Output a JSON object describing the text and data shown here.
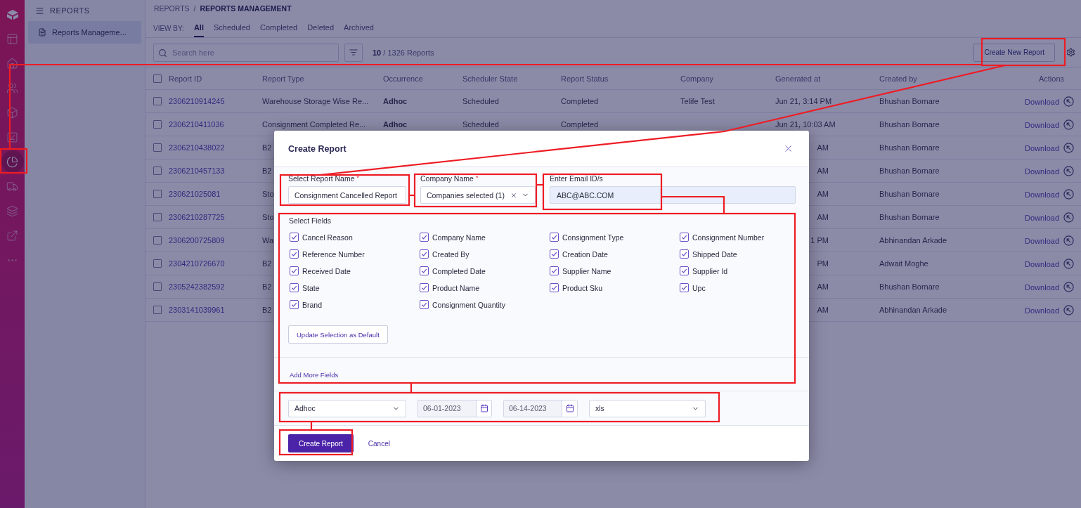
{
  "rail": {
    "items": [
      {
        "kind": "logo",
        "selected": false
      },
      {
        "kind": "layout",
        "selected": false
      },
      {
        "kind": "home",
        "selected": false
      },
      {
        "kind": "users",
        "selected": false
      },
      {
        "kind": "box",
        "selected": false
      },
      {
        "kind": "inbound",
        "selected": false
      },
      {
        "kind": "reports",
        "selected": true
      },
      {
        "kind": "truck",
        "selected": false
      },
      {
        "kind": "layers",
        "selected": false
      },
      {
        "kind": "external",
        "selected": false
      },
      {
        "kind": "more",
        "selected": false
      }
    ]
  },
  "sidebar": {
    "title": "REPORTS",
    "items": [
      {
        "label": "Reports Manageme...",
        "selected": true
      }
    ]
  },
  "breadcrumb": {
    "items": [
      "REPORTS",
      "REPORTS MANAGEMENT"
    ],
    "separator": "/"
  },
  "view_by": {
    "label": "VIEW BY:",
    "tabs": [
      {
        "label": "All",
        "selected": true
      },
      {
        "label": "Scheduled",
        "selected": false
      },
      {
        "label": "Completed",
        "selected": false
      },
      {
        "label": "Deleted",
        "selected": false
      },
      {
        "label": "Archived",
        "selected": false
      }
    ]
  },
  "toolbar": {
    "search_placeholder": "Search here",
    "count": "**10** / 1326 Reports",
    "create_button": "Create New Report"
  },
  "table": {
    "all_checked": false,
    "columns": [
      "Report ID",
      "Report Type",
      "Occurrence",
      "Scheduler State",
      "Report Status",
      "Company",
      "Generated at",
      "Created by",
      "Actions"
    ],
    "rows": [
      {
        "checked": false,
        "id": "2306210914245",
        "type": "Warehouse Storage Wise Re...",
        "occurrence": "Adhoc",
        "scheduler_state": "Scheduled",
        "status": "Completed",
        "company": "Telife Test",
        "generated_at": "Jun 21, 3:14 PM",
        "generated_cut": false,
        "created_by": "Bhushan Bornare",
        "action": "Download"
      },
      {
        "checked": false,
        "id": "2306210411036",
        "type": "Consignment Completed Re...",
        "occurrence": "Adhoc",
        "scheduler_state": "Scheduled",
        "status": "Completed",
        "generated_at": "Jun 21, 10:03 AM",
        "generated_cut": false,
        "created_by": "Bhushan Bornare",
        "action": "Download"
      },
      {
        "checked": false,
        "id": "2306210438022",
        "type": "B2",
        "generated_at": "AM",
        "generated_cut": true,
        "created_by": "Bhushan Bornare",
        "action": "Download"
      },
      {
        "checked": false,
        "id": "2306210457133",
        "type": "B2",
        "generated_at": "AM",
        "generated_cut": true,
        "created_by": "Bhushan Bornare",
        "action": "Download"
      },
      {
        "checked": false,
        "id": "230621025081",
        "type": "Sto",
        "generated_at": "AM",
        "generated_cut": true,
        "created_by": "Bhushan Bornare",
        "action": "Download"
      },
      {
        "checked": false,
        "id": "2306210287725",
        "type": "Sto",
        "generated_at": "AM",
        "generated_cut": true,
        "created_by": "Bhushan Bornare",
        "action": "Download"
      },
      {
        "checked": false,
        "id": "2306200725809",
        "type": "Wa",
        "generated_at": "1 PM",
        "generated_cut": true,
        "created_by": "Abhinandan Arkade",
        "action": "Download"
      },
      {
        "checked": false,
        "id": "2304210726670",
        "type": "B2",
        "generated_at": "PM",
        "generated_cut": true,
        "created_by": "Adwait Moghe",
        "action": "Download"
      },
      {
        "checked": false,
        "id": "2305242382592",
        "type": "B2",
        "generated_at": "AM",
        "generated_cut": true,
        "created_by": "Bhushan Bornare",
        "action": "Download"
      },
      {
        "checked": false,
        "id": "2303141039961",
        "type": "B2",
        "generated_at": "AM",
        "generated_cut": true,
        "created_by": "Abhinandan Arkade",
        "action": "Download"
      }
    ]
  },
  "modal": {
    "title": "Create Report",
    "report_name": {
      "label": "Select Report Name",
      "required_mark": "*",
      "value": "Consignment Cancelled Report"
    },
    "company": {
      "label": "Company Name",
      "required_mark": "*",
      "value": "Companies selected (1)"
    },
    "email": {
      "label": "Enter Email ID/s",
      "value": "ABC@ABC.COM"
    },
    "fields_title": "Select Fields",
    "fields": [
      {
        "label": "Cancel Reason",
        "checked": true
      },
      {
        "label": "Company Name",
        "checked": true
      },
      {
        "label": "Consignment Type",
        "checked": true
      },
      {
        "label": "Consignment Number",
        "checked": true
      },
      {
        "label": "Reference Number",
        "checked": true
      },
      {
        "label": "Created By",
        "checked": true
      },
      {
        "label": "Creation Date",
        "checked": true
      },
      {
        "label": "Shipped Date",
        "checked": true
      },
      {
        "label": "Received Date",
        "checked": true
      },
      {
        "label": "Completed Date",
        "checked": true
      },
      {
        "label": "Supplier Name",
        "checked": true
      },
      {
        "label": "Supplier Id",
        "checked": true
      },
      {
        "label": "State",
        "checked": true
      },
      {
        "label": "Product Name",
        "checked": true
      },
      {
        "label": "Product Sku",
        "checked": true
      },
      {
        "label": "Upc",
        "checked": true
      },
      {
        "label": "Brand",
        "checked": true
      },
      {
        "label": "Consignment Quantity",
        "checked": true
      }
    ],
    "update_button": "Update Selection as Default",
    "add_fields_link": "Add More Fields",
    "schedule": {
      "occurrence": "Adhoc",
      "date_from": {
        "value": "06-01-2023",
        "disabled": true
      },
      "date_to": {
        "value": "06-14-2023",
        "disabled": true
      },
      "format": "xls"
    },
    "submit_button": "Create Report",
    "cancel_link": "Cancel"
  }
}
